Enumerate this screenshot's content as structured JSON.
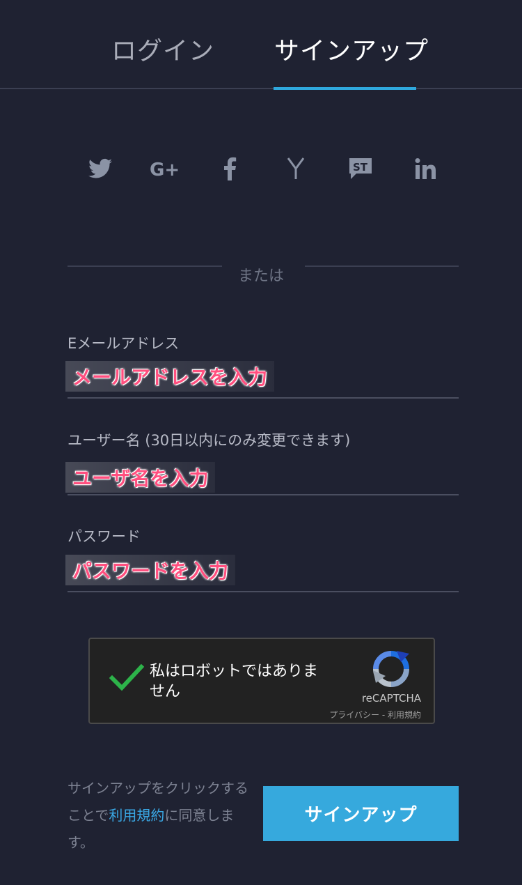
{
  "tabs": {
    "login": "ログイン",
    "signup": "サインアップ"
  },
  "social": [
    "twitter-icon",
    "google-plus-icon",
    "facebook-icon",
    "yahoo-icon",
    "st-icon",
    "linkedin-icon"
  ],
  "divider_text": "または",
  "form": {
    "email_label": "Eメールアドレス",
    "email_hint": "メールアドレスを入力",
    "username_label": "ユーザー名 (30日以内にのみ変更できます)",
    "username_hint": "ユーザ名を入力",
    "password_label": "パスワード",
    "password_hint": "パスワードを入力"
  },
  "captcha": {
    "text": "私はロボットではありません",
    "brand": "reCAPTCHA",
    "links": "プライバシー - 利用規約"
  },
  "footer": {
    "agree_prefix": "サインアップをクリックすることで",
    "terms_link": "利用規約",
    "agree_suffix": "に同意します。",
    "signup_button": "サインアップ"
  },
  "colors": {
    "background": "#1f2232",
    "accent": "#36a9dd",
    "highlight": "#ff4f7f"
  }
}
